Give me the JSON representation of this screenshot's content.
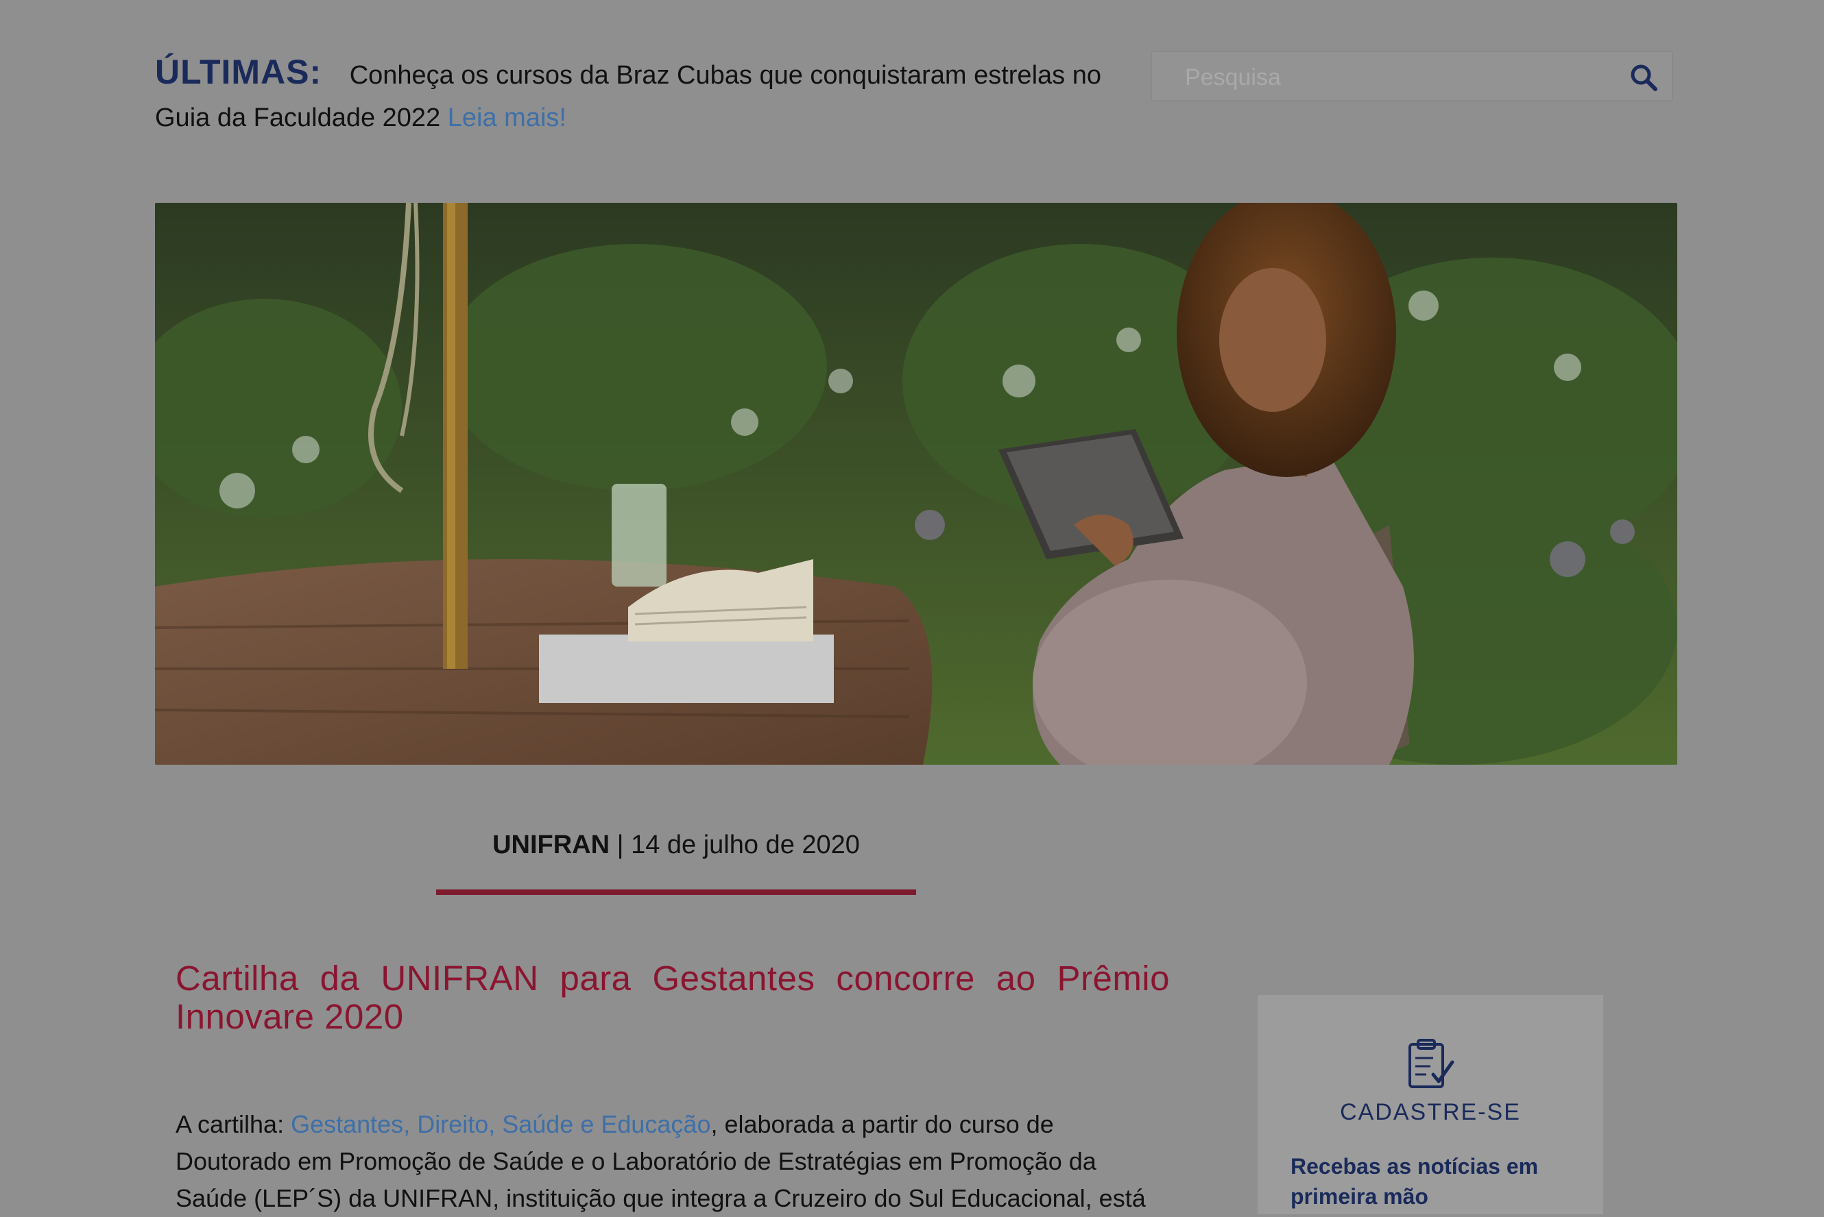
{
  "ticker": {
    "label": "ÚLTIMAS:",
    "text": "Conheça os cursos da Braz Cubas que conquistaram estrelas no Guia da Faculdade 2022",
    "link": "Leia mais!"
  },
  "search": {
    "placeholder": "Pesquisa"
  },
  "hero": {
    "icon": "photo"
  },
  "meta": {
    "org": "UNIFRAN",
    "separator": " | ",
    "date": "14 de julho de 2020"
  },
  "article": {
    "title": "Cartilha da UNIFRAN para Gestantes concorre ao Prêmio Innovare 2020",
    "body_prefix": "A cartilha: ",
    "body_link": "Gestantes, Direito, Saúde e Educação",
    "body_suffix": ", elaborada a partir do curso de Doutorado em Promoção de Saúde e o Laboratório de Estratégias em Promoção da Saúde (LEP´S) da UNIFRAN, instituição que integra a Cruzeiro do Sul Educacional, está"
  },
  "sidebar": {
    "icon": "clipboard-check-icon",
    "heading": "CADASTRE-SE",
    "description": "Recebas as notícias em primeira mão"
  },
  "colors": {
    "accent": "#8a1530",
    "navy": "#1a2a5a",
    "link": "#3e6fa8"
  }
}
